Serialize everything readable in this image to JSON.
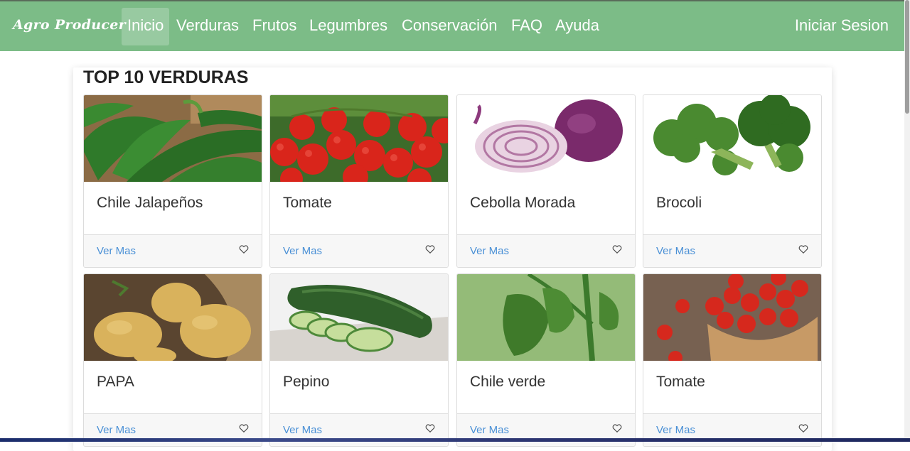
{
  "nav": {
    "brand": "Agro Producer",
    "items": [
      "Inicio",
      "Verduras",
      "Frutos",
      "Legumbres",
      "Conservación",
      "FAQ",
      "Ayuda"
    ],
    "active": "Inicio",
    "login": "Iniciar Sesion"
  },
  "section": {
    "title": "TOP 10 VERDURAS"
  },
  "cards": [
    {
      "title": "Chile Jalapeños",
      "link": "Ver Mas",
      "icon": "heart-icon"
    },
    {
      "title": "Tomate",
      "link": "Ver Mas",
      "icon": "heart-icon"
    },
    {
      "title": "Cebolla Morada",
      "link": "Ver Mas",
      "icon": "heart-icon"
    },
    {
      "title": "Brocoli",
      "link": "Ver Mas",
      "icon": "heart-icon"
    },
    {
      "title": "PAPA",
      "link": "Ver Mas",
      "icon": "heart-icon"
    },
    {
      "title": "Pepino",
      "link": "Ver Mas",
      "icon": "heart-icon"
    },
    {
      "title": "Chile verde",
      "link": "Ver Mas",
      "icon": "heart-icon"
    },
    {
      "title": "Tomate",
      "link": "Ver Mas",
      "icon": "heart-icon"
    }
  ],
  "colors": {
    "navbar": "#7cbc87",
    "link": "#4a90d6"
  }
}
